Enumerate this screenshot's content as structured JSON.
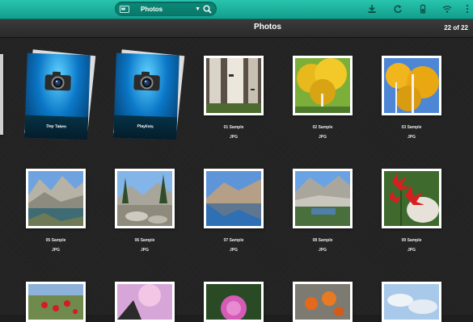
{
  "topbar": {
    "selector_label": "Photos",
    "icons": [
      "folder-icon",
      "chevron-down-icon",
      "search-icon",
      "download-icon",
      "refresh-icon",
      "battery-icon",
      "wifi-icon",
      "more-icon"
    ]
  },
  "header": {
    "title": "Photos",
    "count": "22 of 22"
  },
  "albums": [
    {
      "label": "Day Taken"
    },
    {
      "label": "Playlists"
    }
  ],
  "photos": [
    {
      "name": "01 Sample",
      "type": "JPG"
    },
    {
      "name": "02 Sample",
      "type": "JPG"
    },
    {
      "name": "03 Sample",
      "type": "JPG"
    },
    {
      "name": "05 Sample",
      "type": "JPG"
    },
    {
      "name": "06 Sample",
      "type": "JPG"
    },
    {
      "name": "07 Sample",
      "type": "JPG"
    },
    {
      "name": "08 Sample",
      "type": "JPG"
    },
    {
      "name": "09 Sample",
      "type": "JPG"
    }
  ],
  "colors": {
    "topbar": "#1fb09c",
    "header": "#333333",
    "background": "#242424"
  }
}
